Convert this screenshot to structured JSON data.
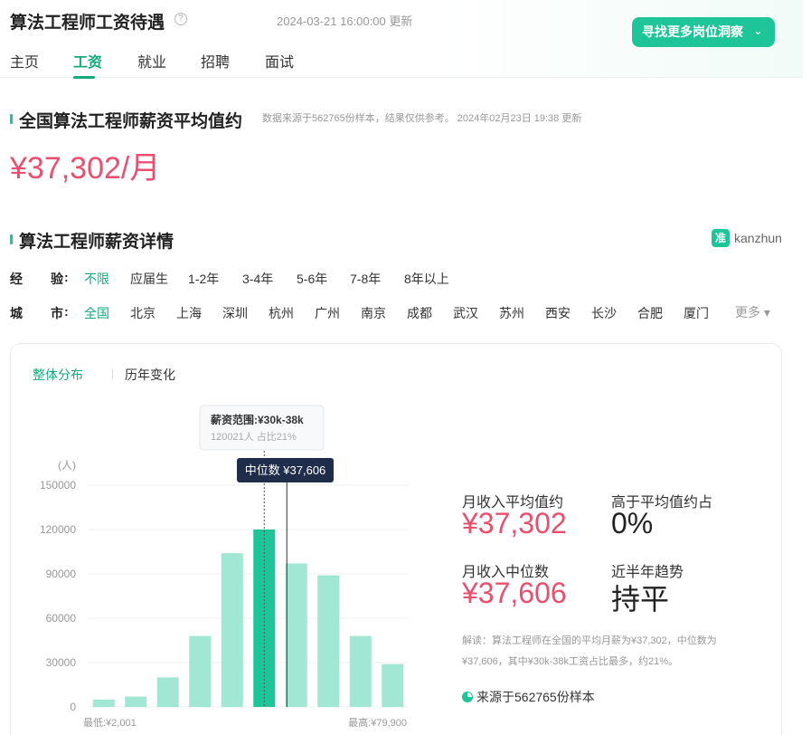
{
  "header": {
    "title": "算法工程师工资待遇",
    "update_time": "2024-03-21 16:00:00 更新",
    "find_button": "寻找更多岗位洞察",
    "tabs": [
      "主页",
      "工资",
      "就业",
      "招聘",
      "面试"
    ],
    "active_tab": "工资"
  },
  "avg_section": {
    "title": "全国算法工程师薪资平均值约",
    "note": "数据来源于562765份样本，结果仅供参考。  2024年02月23日 19:38 更新",
    "avg_salary": "¥37,302/月"
  },
  "detail_section": {
    "title": "算法工程师薪资详情",
    "brand": "kanzhun",
    "brand_logo_char": "准"
  },
  "filters": {
    "experience_label": "经",
    "experience_label2": "验",
    "experience_colon": ":",
    "experience": [
      "不限",
      "应届生",
      "1-2年",
      "3-4年",
      "5-6年",
      "7-8年",
      "8年以上"
    ],
    "city_label": "城",
    "city_label2": "市",
    "city_colon": ":",
    "cities": [
      "全国",
      "北京",
      "上海",
      "深圳",
      "杭州",
      "广州",
      "南京",
      "成都",
      "武汉",
      "苏州",
      "西安",
      "长沙",
      "合肥",
      "厦门"
    ],
    "more": "更多 ▾"
  },
  "subtabs": [
    "整体分布",
    "历年变化"
  ],
  "chart_data": {
    "type": "bar",
    "ylabel": "(人)",
    "ylim": [
      0,
      150000
    ],
    "yticks": [
      0,
      30000,
      60000,
      90000,
      120000,
      150000
    ],
    "min_label": "最低:¥2,001",
    "max_label": "最高:¥79,900",
    "values": [
      5000,
      7000,
      20000,
      48000,
      104000,
      120021,
      97000,
      89000,
      48000,
      29000
    ],
    "highlight_index": 5,
    "tooltip": {
      "title": "薪资范围:¥30k-38k",
      "detail": "120021人  占比21%"
    },
    "median_label": "中位数 ¥37,606",
    "bar_color": "#a2e6d4",
    "highlight_color": "#1ec598"
  },
  "stats": {
    "avg_label": "月收入平均值约",
    "avg_value": "¥37,302",
    "above_label": "高于平均值约占",
    "above_value": "0%",
    "median_label": "月收入中位数",
    "median_value": "¥37,606",
    "trend_label": "近半年趋势",
    "trend_value": "持平"
  },
  "explanation": "解读：算法工程师在全国的平均月薪为¥37,302，中位数为¥37,606，其中¥30k-38k工资占比最多，约21%。",
  "source": "来源于562765份样本"
}
